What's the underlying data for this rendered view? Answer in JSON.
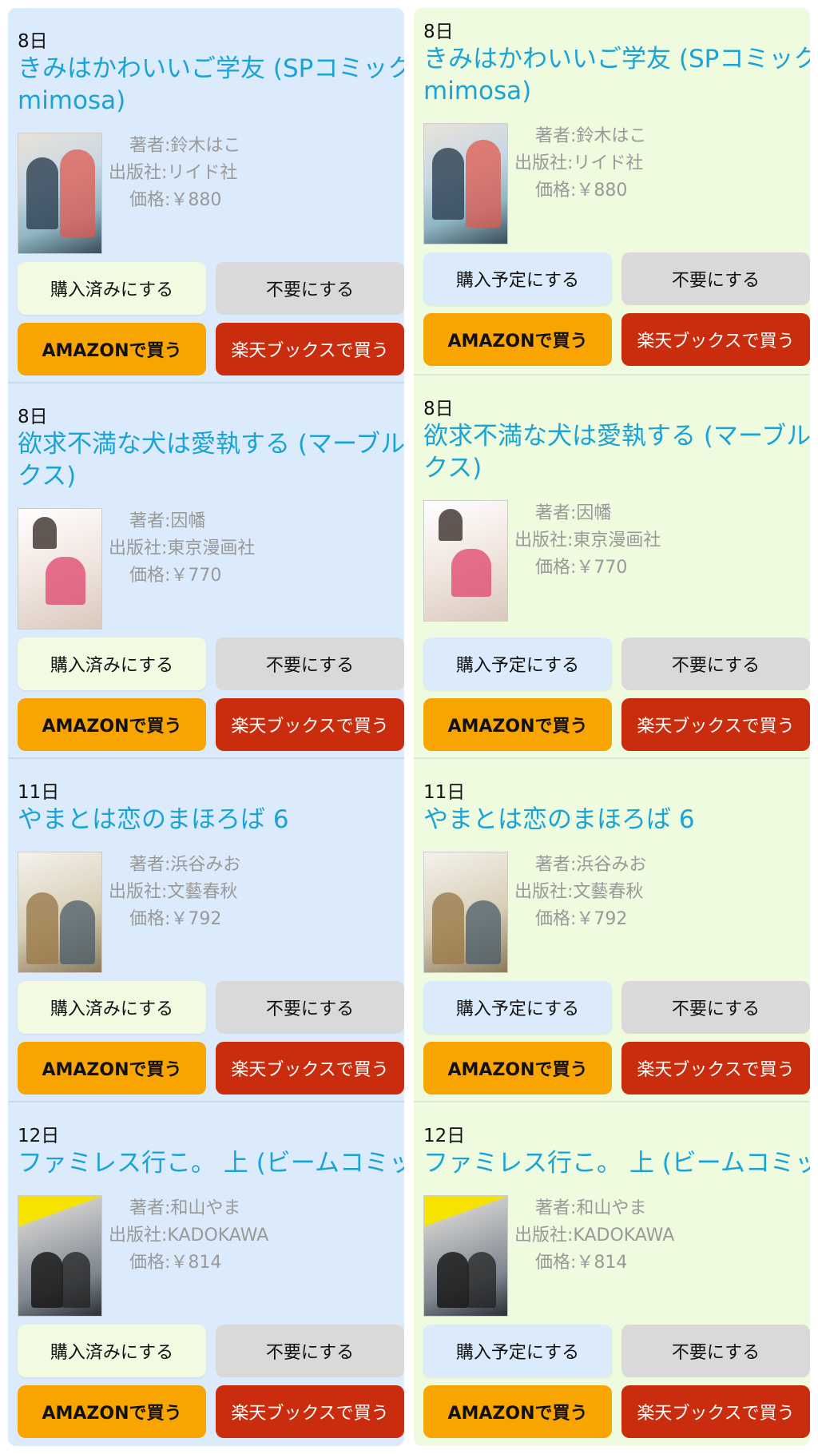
{
  "colors": {
    "left_bg": "#dcebfb",
    "right_bg": "#eefbdf",
    "title": "#1aa3d6",
    "amazon": "#f9a501",
    "rakuten": "#c92d0e",
    "ignore": "#d9d9d9"
  },
  "columns": [
    {
      "purchase_label": "購入済みにする",
      "items": [
        {
          "date": "8日",
          "title_lines": [
            "きみはかわいいご学友 (SPコミックス",
            "mimosa)"
          ],
          "author": "著者:鈴木はこ",
          "publisher": "出版社:リイド社",
          "price": "価格:￥880",
          "ignore_label": "不要にする",
          "amazon_label": "AMAZONで買う",
          "rakuten_label": "楽天ブックスで買う"
        },
        {
          "date": "8日",
          "title_lines": [
            "欲求不満な犬は愛執する (マーブルコミ",
            "クス)"
          ],
          "author": "著者:因幡",
          "publisher": "出版社:東京漫画社",
          "price": "価格:￥770",
          "ignore_label": "不要にする",
          "amazon_label": "AMAZONで買う",
          "rakuten_label": "楽天ブックスで買う"
        },
        {
          "date": "11日",
          "title_lines": [
            "やまとは恋のまほろば 6"
          ],
          "author": "著者:浜谷みお",
          "publisher": "出版社:文藝春秋",
          "price": "価格:￥792",
          "ignore_label": "不要にする",
          "amazon_label": "AMAZONで買う",
          "rakuten_label": "楽天ブックスで買う"
        },
        {
          "date": "12日",
          "title_lines": [
            "ファミレス行こ。 上 (ビームコミックス)"
          ],
          "author": "著者:和山やま",
          "publisher": "出版社:KADOKAWA",
          "price": "価格:￥814",
          "ignore_label": "不要にする",
          "amazon_label": "AMAZONで買う",
          "rakuten_label": "楽天ブックスで買う"
        }
      ]
    },
    {
      "purchase_label": "購入予定にする",
      "items": [
        {
          "date": "8日",
          "title_lines": [
            "きみはかわいいご学友 (SPコミックス",
            "mimosa)"
          ],
          "author": "著者:鈴木はこ",
          "publisher": "出版社:リイド社",
          "price": "価格:￥880",
          "ignore_label": "不要にする",
          "amazon_label": "AMAZONで買う",
          "rakuten_label": "楽天ブックスで買う"
        },
        {
          "date": "8日",
          "title_lines": [
            "欲求不満な犬は愛執する (マーブルコミ",
            "クス)"
          ],
          "author": "著者:因幡",
          "publisher": "出版社:東京漫画社",
          "price": "価格:￥770",
          "ignore_label": "不要にする",
          "amazon_label": "AMAZONで買う",
          "rakuten_label": "楽天ブックスで買う"
        },
        {
          "date": "11日",
          "title_lines": [
            "やまとは恋のまほろば 6"
          ],
          "author": "著者:浜谷みお",
          "publisher": "出版社:文藝春秋",
          "price": "価格:￥792",
          "ignore_label": "不要にする",
          "amazon_label": "AMAZONで買う",
          "rakuten_label": "楽天ブックスで買う"
        },
        {
          "date": "12日",
          "title_lines": [
            "ファミレス行こ。 上 (ビームコミックス)"
          ],
          "author": "著者:和山やま",
          "publisher": "出版社:KADOKAWA",
          "price": "価格:￥814",
          "ignore_label": "不要にする",
          "amazon_label": "AMAZONで買う",
          "rakuten_label": "楽天ブックスで買う"
        }
      ]
    }
  ]
}
